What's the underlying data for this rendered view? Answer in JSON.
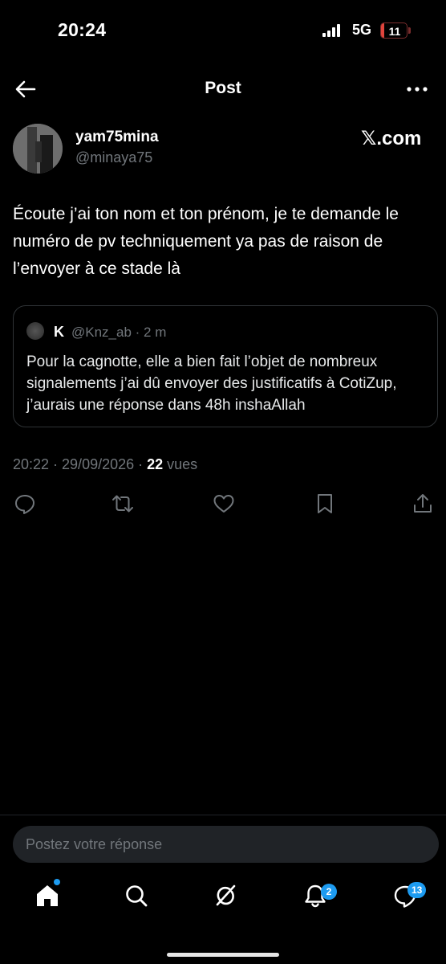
{
  "status_bar": {
    "time": "20:24",
    "network": "5G",
    "battery_level": "11",
    "battery_fraction": 0.11,
    "battery_color": "#e0443c"
  },
  "nav": {
    "title": "Post",
    "back_icon": "arrow-left-icon",
    "more_icon": "more-horizontal-icon"
  },
  "post": {
    "author": {
      "display_name": "yam75mina",
      "handle": "@minaya75"
    },
    "watermark": "𝕏.com",
    "text": "Écoute j’ai ton nom et ton prénom, je te demande le numéro de pv techniquement ya pas de raison de l’envoyer à ce stade là",
    "quoted": {
      "name": "K",
      "meta": "@Knz_ab · 2 m",
      "text": "Pour la cagnotte, elle a bien fait l’objet de nombreux signalements j’ai dû envoyer des justificatifs à CotiZup, j’aurais une réponse dans 48h inshaAllah"
    },
    "timestamp": "20:22 · 29/09/2026 · ",
    "views_count": "22",
    "views_label": " vues",
    "actions": [
      "reply-icon",
      "retweet-icon",
      "like-icon",
      "bookmark-icon",
      "share-icon"
    ]
  },
  "reply": {
    "placeholder": "Postez votre réponse"
  },
  "tabbar": {
    "items": [
      "home-icon",
      "search-icon",
      "grok-icon",
      "notifications-icon",
      "messages-icon"
    ],
    "notifications_badge": "2",
    "messages_badge": "13",
    "accent": "#1d9bf0"
  },
  "colors": {
    "background": "#000000",
    "text_primary": "#e7e9ea",
    "text_secondary": "#71767b",
    "border": "#2f3336"
  }
}
